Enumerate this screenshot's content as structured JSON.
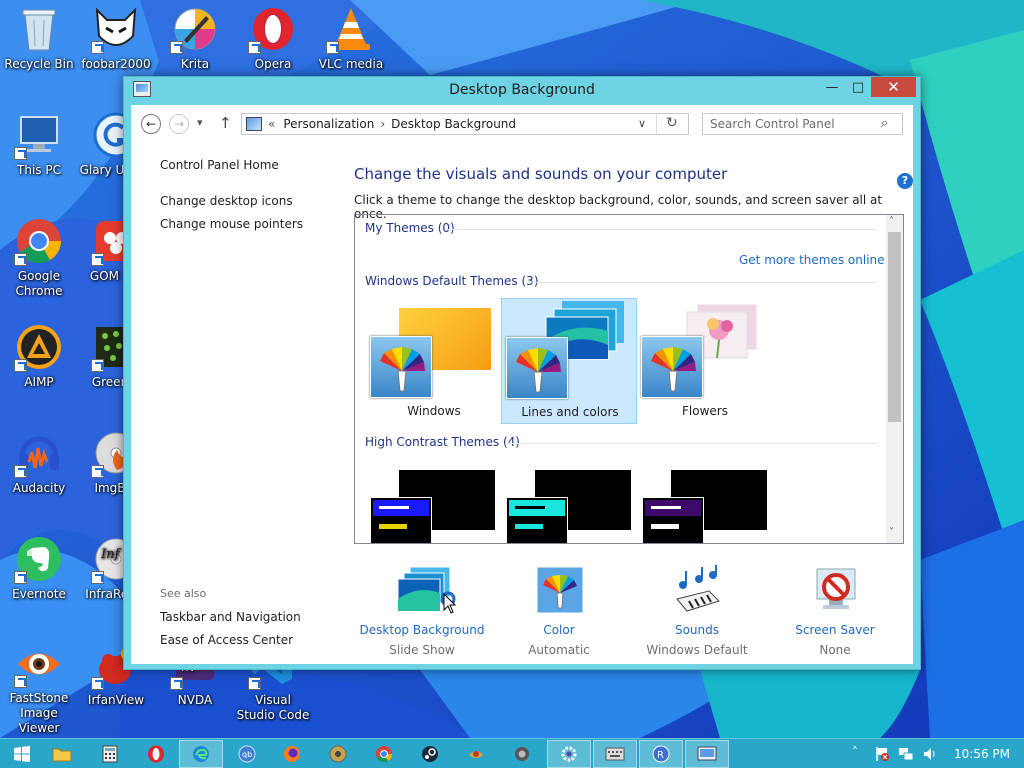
{
  "desktop": {
    "icons": [
      {
        "label": "Recycle Bin",
        "icon": "recycle-bin-icon"
      },
      {
        "label": "foobar2000",
        "icon": "foobar2000-icon"
      },
      {
        "label": "Krita",
        "icon": "krita-icon"
      },
      {
        "label": "Opera",
        "icon": "opera-icon"
      },
      {
        "label": "VLC media",
        "icon": "vlc-icon"
      },
      {
        "label": "This PC",
        "icon": "this-pc-icon"
      },
      {
        "label": "Glary Ut… 5",
        "icon": "glary-utilities-icon"
      },
      {
        "label": "Google Chrome",
        "icon": "chrome-icon"
      },
      {
        "label": "GOM P…",
        "icon": "gom-player-icon"
      },
      {
        "label": "AIMP",
        "icon": "aimp-icon"
      },
      {
        "label": "Green…",
        "icon": "greenshot-icon"
      },
      {
        "label": "Audacity",
        "icon": "audacity-icon"
      },
      {
        "label": "ImgB…",
        "icon": "imgburn-icon"
      },
      {
        "label": "Evernote",
        "icon": "evernote-icon"
      },
      {
        "label": "InfraRec…",
        "icon": "infrarecorder-icon"
      },
      {
        "label": "FastStone Image Viewer",
        "icon": "faststone-icon"
      },
      {
        "label": "IrfanView",
        "icon": "irfanview-icon"
      },
      {
        "label": "NVDA",
        "icon": "nvda-icon"
      },
      {
        "label": "Visual Studio Code",
        "icon": "vscode-icon"
      }
    ]
  },
  "window": {
    "title": "Desktop Background",
    "controls": {
      "minimize": "—",
      "maximize": "□",
      "close": "✕"
    },
    "nav": {
      "back": "←",
      "forward": "→",
      "recent": "▾",
      "up": "↑",
      "breadcrumb_prefix": "«",
      "breadcrumb": [
        "Personalization",
        "Desktop Background"
      ],
      "separator": "›",
      "dropdown": "∨",
      "refresh": "↻",
      "search_placeholder": "Search Control Panel",
      "search_glyph": "⌕"
    },
    "help_glyph": "?",
    "left_pane": {
      "links": [
        "Control Panel Home",
        "Change desktop icons",
        "Change mouse pointers"
      ],
      "see_also_label": "See also",
      "see_also_links": [
        "Taskbar and Navigation",
        "Ease of Access Center"
      ]
    },
    "main": {
      "heading": "Change the visuals and sounds on your computer",
      "description": "Click a theme to change the desktop background, color, sounds, and screen saver all at once.",
      "groups": {
        "my_themes": "My Themes (0)",
        "get_more": "Get more themes online",
        "default_themes": "Windows Default Themes (3)",
        "high_contrast": "High Contrast Themes (4)"
      },
      "default_themes": [
        {
          "name": "Windows",
          "selected": false
        },
        {
          "name": "Lines and colors",
          "selected": true
        },
        {
          "name": "Flowers",
          "selected": false
        }
      ],
      "scroll_glyphs": {
        "up": "˄",
        "down": "˅"
      }
    },
    "settings": [
      {
        "name": "Desktop Background",
        "value": "Slide Show"
      },
      {
        "name": "Color",
        "value": "Automatic"
      },
      {
        "name": "Sounds",
        "value": "Windows Default"
      },
      {
        "name": "Screen Saver",
        "value": "None"
      }
    ]
  },
  "taskbar": {
    "clock": "10:56 PM",
    "tray_glyphs": {
      "chevron": "˄"
    },
    "colors": {
      "bar": "#29a6c9"
    }
  }
}
